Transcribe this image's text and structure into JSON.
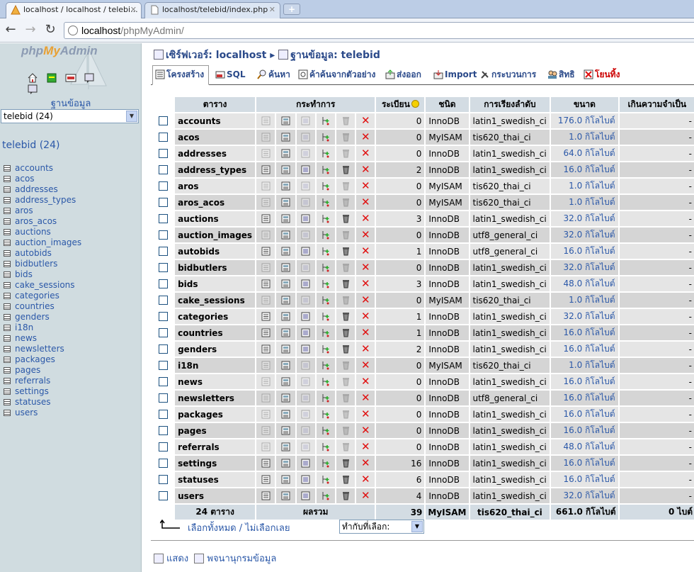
{
  "browser": {
    "tabs": [
      {
        "label": "localhost / localhost / telebi...",
        "active": true
      },
      {
        "label": "localhost/telebid/index.php",
        "active": false
      }
    ],
    "new_tab": "+",
    "url_host": "localhost",
    "url_path": "/phpMyAdmin/"
  },
  "sidebar": {
    "logo_php": "php",
    "logo_my": "My",
    "logo_admin": "Admin",
    "db_label": "ฐานข้อมูล",
    "db_select": "telebid (24)",
    "db_heading": "telebid (24)",
    "tables": [
      "accounts",
      "acos",
      "addresses",
      "address_types",
      "aros",
      "aros_acos",
      "auctions",
      "auction_images",
      "autobids",
      "bidbutlers",
      "bids",
      "cake_sessions",
      "categories",
      "countries",
      "genders",
      "i18n",
      "news",
      "newsletters",
      "packages",
      "pages",
      "referrals",
      "settings",
      "statuses",
      "users"
    ]
  },
  "breadcrumb": {
    "server_label": "เซิร์ฟเวอร์: localhost",
    "sep": "▸",
    "db_label": "ฐานข้อมูล: telebid"
  },
  "tabs": {
    "structure": "โครงสร้าง",
    "sql": "SQL",
    "search": "ค้นหา",
    "query": "ค้าค้นจากตัวอย่าง",
    "export": "ส่งออก",
    "import": "Import",
    "operations": "กระบวนการ",
    "privileges": "สิทธิ",
    "drop": "โยนทิ้ง"
  },
  "table": {
    "headers": {
      "table": "ตาราง",
      "action": "กระทำการ",
      "records": "ระเบียน",
      "type": "ชนิด",
      "collation": "การเรียงลำดับ",
      "size": "ขนาด",
      "overhead": "เกินความจำเป็น"
    },
    "rows": [
      {
        "name": "accounts",
        "records": "0",
        "type": "InnoDB",
        "collation": "latin1_swedish_ci",
        "size": "176.0 กิโลไบต์",
        "overhead": "-"
      },
      {
        "name": "acos",
        "records": "0",
        "type": "MyISAM",
        "collation": "tis620_thai_ci",
        "size": "1.0 กิโลไบต์",
        "overhead": "-"
      },
      {
        "name": "addresses",
        "records": "0",
        "type": "InnoDB",
        "collation": "latin1_swedish_ci",
        "size": "64.0 กิโลไบต์",
        "overhead": "-"
      },
      {
        "name": "address_types",
        "records": "2",
        "type": "InnoDB",
        "collation": "latin1_swedish_ci",
        "size": "16.0 กิโลไบต์",
        "overhead": "-"
      },
      {
        "name": "aros",
        "records": "0",
        "type": "MyISAM",
        "collation": "tis620_thai_ci",
        "size": "1.0 กิโลไบต์",
        "overhead": "-"
      },
      {
        "name": "aros_acos",
        "records": "0",
        "type": "MyISAM",
        "collation": "tis620_thai_ci",
        "size": "1.0 กิโลไบต์",
        "overhead": "-"
      },
      {
        "name": "auctions",
        "records": "3",
        "type": "InnoDB",
        "collation": "latin1_swedish_ci",
        "size": "32.0 กิโลไบต์",
        "overhead": "-"
      },
      {
        "name": "auction_images",
        "records": "0",
        "type": "InnoDB",
        "collation": "utf8_general_ci",
        "size": "32.0 กิโลไบต์",
        "overhead": "-"
      },
      {
        "name": "autobids",
        "records": "1",
        "type": "InnoDB",
        "collation": "utf8_general_ci",
        "size": "16.0 กิโลไบต์",
        "overhead": "-"
      },
      {
        "name": "bidbutlers",
        "records": "0",
        "type": "InnoDB",
        "collation": "latin1_swedish_ci",
        "size": "32.0 กิโลไบต์",
        "overhead": "-"
      },
      {
        "name": "bids",
        "records": "3",
        "type": "InnoDB",
        "collation": "latin1_swedish_ci",
        "size": "48.0 กิโลไบต์",
        "overhead": "-"
      },
      {
        "name": "cake_sessions",
        "records": "0",
        "type": "MyISAM",
        "collation": "tis620_thai_ci",
        "size": "1.0 กิโลไบต์",
        "overhead": "-"
      },
      {
        "name": "categories",
        "records": "1",
        "type": "InnoDB",
        "collation": "latin1_swedish_ci",
        "size": "32.0 กิโลไบต์",
        "overhead": "-"
      },
      {
        "name": "countries",
        "records": "1",
        "type": "InnoDB",
        "collation": "latin1_swedish_ci",
        "size": "16.0 กิโลไบต์",
        "overhead": "-"
      },
      {
        "name": "genders",
        "records": "2",
        "type": "InnoDB",
        "collation": "latin1_swedish_ci",
        "size": "16.0 กิโลไบต์",
        "overhead": "-"
      },
      {
        "name": "i18n",
        "records": "0",
        "type": "MyISAM",
        "collation": "tis620_thai_ci",
        "size": "1.0 กิโลไบต์",
        "overhead": "-"
      },
      {
        "name": "news",
        "records": "0",
        "type": "InnoDB",
        "collation": "latin1_swedish_ci",
        "size": "16.0 กิโลไบต์",
        "overhead": "-"
      },
      {
        "name": "newsletters",
        "records": "0",
        "type": "InnoDB",
        "collation": "utf8_general_ci",
        "size": "16.0 กิโลไบต์",
        "overhead": "-"
      },
      {
        "name": "packages",
        "records": "0",
        "type": "InnoDB",
        "collation": "latin1_swedish_ci",
        "size": "16.0 กิโลไบต์",
        "overhead": "-"
      },
      {
        "name": "pages",
        "records": "0",
        "type": "InnoDB",
        "collation": "latin1_swedish_ci",
        "size": "16.0 กิโลไบต์",
        "overhead": "-"
      },
      {
        "name": "referrals",
        "records": "0",
        "type": "InnoDB",
        "collation": "latin1_swedish_ci",
        "size": "48.0 กิโลไบต์",
        "overhead": "-"
      },
      {
        "name": "settings",
        "records": "16",
        "type": "InnoDB",
        "collation": "latin1_swedish_ci",
        "size": "16.0 กิโลไบต์",
        "overhead": "-"
      },
      {
        "name": "statuses",
        "records": "6",
        "type": "InnoDB",
        "collation": "latin1_swedish_ci",
        "size": "16.0 กิโลไบต์",
        "overhead": "-"
      },
      {
        "name": "users",
        "records": "4",
        "type": "InnoDB",
        "collation": "latin1_swedish_ci",
        "size": "32.0 กิโลไบต์",
        "overhead": "-"
      }
    ],
    "footer": {
      "count": "24 ตาราง",
      "total_label": "ผลรวม",
      "records": "39",
      "type": "MyISAM",
      "collation": "tis620_thai_ci",
      "size": "661.0 กิโลไบต์",
      "overhead": "0 ไบต์"
    }
  },
  "selection": {
    "check_all": "เลือกทั้งหมด",
    "sep": " / ",
    "uncheck_all": "ไม่เลือกเลย",
    "with_selected": "ทำกับที่เลือก:"
  },
  "bottom": {
    "print": "แสดง",
    "dictionary": "พจนานุกรมข้อมูล"
  },
  "colors": {
    "sidebar_bg": "#d0dce0",
    "link": "#2b58a8",
    "header_bg": "#d3dce3",
    "row_odd": "#e5e5e5",
    "row_even": "#d5d5d5",
    "delete_red": "#e01010"
  }
}
